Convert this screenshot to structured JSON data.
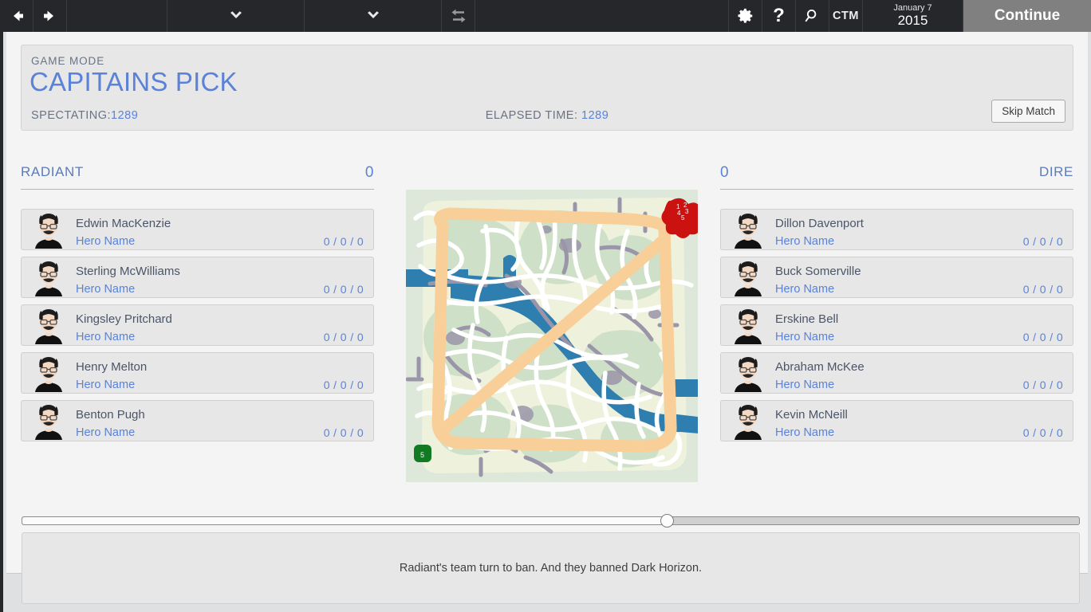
{
  "toolbar": {
    "back_icon": "arrow-left-icon",
    "forward_icon": "arrow-right-icon",
    "dropdown_icon": "chevron-down-icon",
    "swap_icon": "swap-arrows-icon",
    "settings_icon": "gear-icon",
    "help_icon": "question-mark-icon",
    "search_icon": "magnifier-icon",
    "ctm_label": "CTM",
    "date_day": "January 7",
    "date_year": "2015",
    "continue_label": "Continue"
  },
  "header": {
    "mode_label": "GAME MODE",
    "mode_title": "CAPITAINS PICK",
    "spectating_label": "SPECTATING:",
    "spectating_value": "1289",
    "elapsed_label": "ELAPSED TIME:",
    "elapsed_value": "1289",
    "skip_match_label": "Skip Match"
  },
  "teams": {
    "radiant": {
      "name": "RADIANT",
      "score": "0",
      "players": [
        {
          "name": "Edwin MacKenzie",
          "hero": "Hero Name",
          "kda": "0 / 0 / 0"
        },
        {
          "name": "Sterling McWilliams",
          "hero": "Hero Name",
          "kda": "0 / 0 / 0"
        },
        {
          "name": "Kingsley Pritchard",
          "hero": "Hero Name",
          "kda": "0 / 0 / 0"
        },
        {
          "name": "Henry Melton",
          "hero": "Hero Name",
          "kda": "0 / 0 / 0"
        },
        {
          "name": "Benton Pugh",
          "hero": "Hero Name",
          "kda": "0 / 0 / 0"
        }
      ]
    },
    "dire": {
      "name": "DIRE",
      "score": "0",
      "players": [
        {
          "name": "Dillon Davenport",
          "hero": "Hero Name",
          "kda": "0 / 0 / 0"
        },
        {
          "name": "Buck Somerville",
          "hero": "Hero Name",
          "kda": "0 / 0 / 0"
        },
        {
          "name": "Erskine Bell",
          "hero": "Hero Name",
          "kda": "0 / 0 / 0"
        },
        {
          "name": "Abraham McKee",
          "hero": "Hero Name",
          "kda": "0 / 0 / 0"
        },
        {
          "name": "Kevin McNeill",
          "hero": "Hero Name",
          "kda": "0 / 0 / 0"
        }
      ]
    }
  },
  "minimap": {
    "name": "match-minimap",
    "markers": [
      {
        "id": "dire-cluster",
        "color": "#cc1111",
        "labels": [
          "1",
          "2",
          "3",
          "4",
          "5"
        ]
      },
      {
        "id": "radiant-marker",
        "color": "#117a22",
        "labels": [
          "5"
        ]
      }
    ]
  },
  "timeline": {
    "name": "match-timeline-slider",
    "position_percent": 61
  },
  "message": {
    "text": "Radiant's team turn to ban. And they banned Dark Horizon."
  },
  "colors": {
    "accent_blue": "#5a82d8",
    "muted_blue": "#6a7384",
    "toolbar_bg": "#26272a",
    "continue_bg": "#808080",
    "panel_bg": "#f4f4f4",
    "row_bg": "#e7e7e7"
  }
}
